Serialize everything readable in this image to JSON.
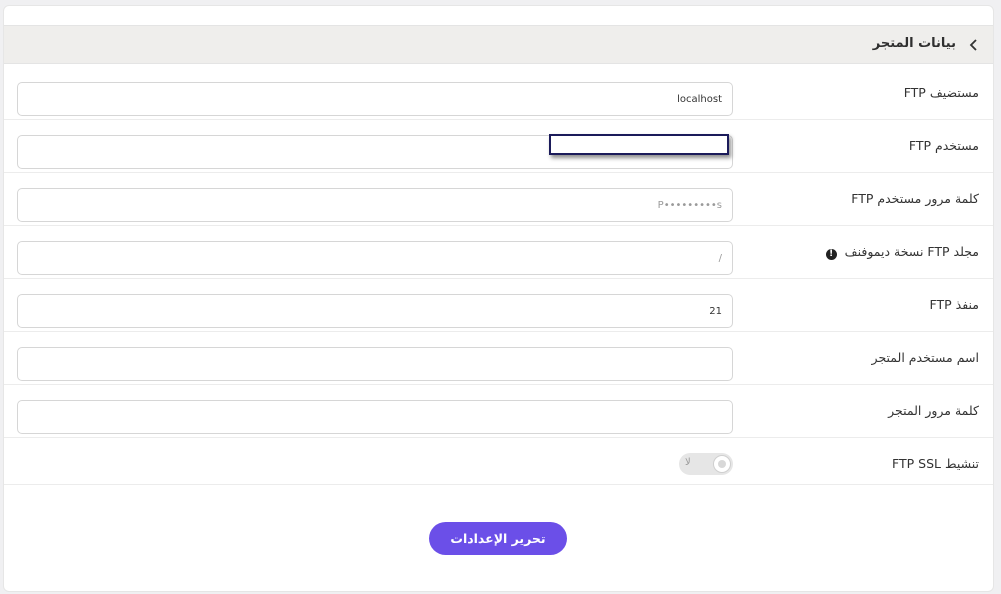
{
  "header": {
    "title": "بيانات المتجر",
    "toggle_icon": "chevron-left-icon"
  },
  "fields": [
    {
      "label": "مستضيف FTP",
      "value": "localhost",
      "placeholder": ""
    },
    {
      "label": "مستخدم FTP",
      "value": "",
      "placeholder": ""
    },
    {
      "label": "كلمة مرور مستخدم FTP",
      "value": "P•••••••••s",
      "placeholder": ""
    },
    {
      "label": "مجلد FTP نسخة ديموفنف",
      "value": "/",
      "placeholder": "",
      "info_icon": "exclamation-info-icon"
    },
    {
      "label": "منفذ FTP",
      "value": "21",
      "placeholder": ""
    },
    {
      "label": "اسم مستخدم المتجر",
      "value": "",
      "placeholder": ""
    },
    {
      "label": "كلمة مرور المتجر",
      "value": "",
      "placeholder": ""
    }
  ],
  "ssl": {
    "label": "تنشيط FTP SSL",
    "toggle_text": "لا",
    "enabled": false
  },
  "actions": {
    "save_label": "تحرير الإعدادات"
  },
  "colors": {
    "accent": "#6b4fe8",
    "header_bg": "#efeeec",
    "focus_outline": "#1b1b5a"
  }
}
